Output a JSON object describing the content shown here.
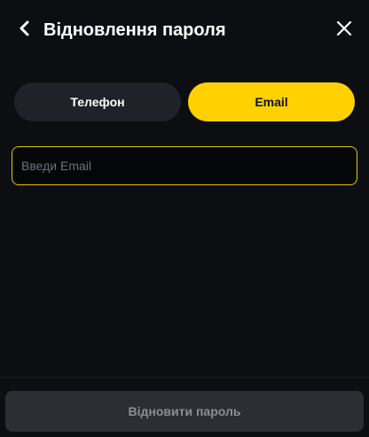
{
  "header": {
    "title": "Відновлення пароля",
    "back_icon": "chevron-left-icon",
    "close_icon": "close-icon"
  },
  "tabs": [
    {
      "label": "Телефон",
      "active": false
    },
    {
      "label": "Email",
      "active": true
    }
  ],
  "email_input": {
    "value": "",
    "placeholder": "Введи Email"
  },
  "footer": {
    "submit_label": "Відновити пароль",
    "submit_enabled": false
  },
  "colors": {
    "background": "#0d0e12",
    "accent": "#ffd100",
    "tab_inactive": "#1f2229",
    "input_border": "#e6c300",
    "button_disabled": "#2c2e34"
  }
}
